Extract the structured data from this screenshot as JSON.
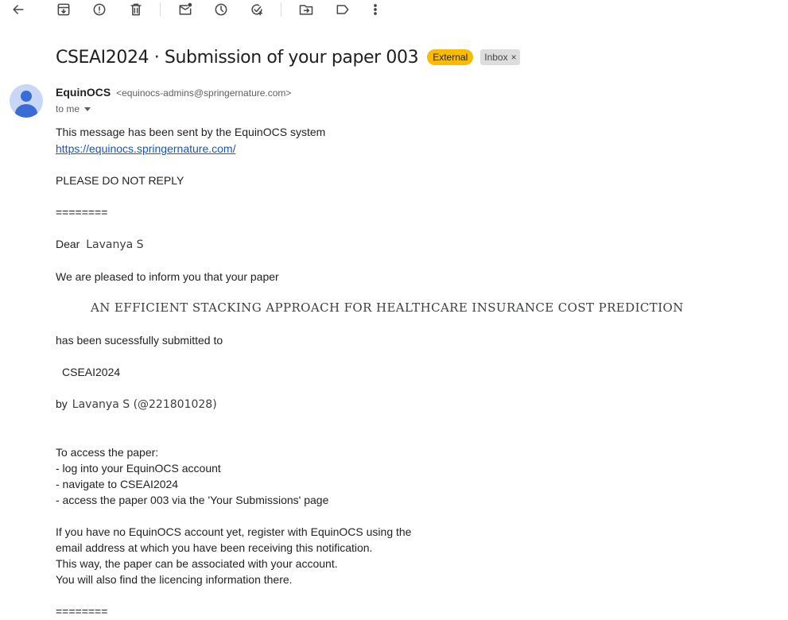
{
  "toolbar": {
    "icons": [
      "back-arrow-icon",
      "archive-icon",
      "report-spam-icon",
      "delete-icon",
      "mark-unread-icon",
      "snooze-icon",
      "add-to-tasks-icon",
      "move-to-icon",
      "label-icon",
      "more-options-icon"
    ]
  },
  "email": {
    "subject": "CSEAI2024 · Submission of your paper 003",
    "labels": {
      "external": "External",
      "inbox": "Inbox",
      "remove": "×"
    },
    "sender": {
      "name": "EquinOCS",
      "email": "<equinocs-admins@springernature.com>",
      "to": "to me"
    },
    "body": {
      "intro": "This message has been sent by the EquinOCS system",
      "link": "https://equinocs.springernature.com/",
      "do_not_reply": "PLEASE DO NOT REPLY",
      "separator": "========",
      "dear_prefix": "Dear ",
      "dear_name": "Lavanya S",
      "pleased": "We are pleased to inform you that your paper",
      "paper_title": "AN EFFICIENT STACKING APPROACH FOR HEALTHCARE INSURANCE COST PREDICTION",
      "submitted_to": "has been sucessfully submitted to",
      "conference": "CSEAI2024",
      "by_prefix": "by",
      "by_author": "Lavanya S (@221801028)",
      "access_heading": "To access the paper:",
      "access_steps": [
        "- log into your EquinOCS account",
        "- navigate to CSEAI2024",
        "- access the paper 003 via the 'Your Submissions' page"
      ],
      "register_lines": [
        "If you have no EquinOCS account yet, register with EquinOCS using the",
        "email address at which you have been receiving this notification.",
        "This way, the paper can be associated with your account.",
        "You will also find the licencing information there."
      ],
      "separator_end": "========"
    }
  },
  "colors": {
    "external_badge": "#f9bc05",
    "inbox_badge": "#dddddd",
    "link": "#1155cc",
    "avatar_bg": "#c7d7f5",
    "avatar_fg": "#3a6cd6"
  }
}
